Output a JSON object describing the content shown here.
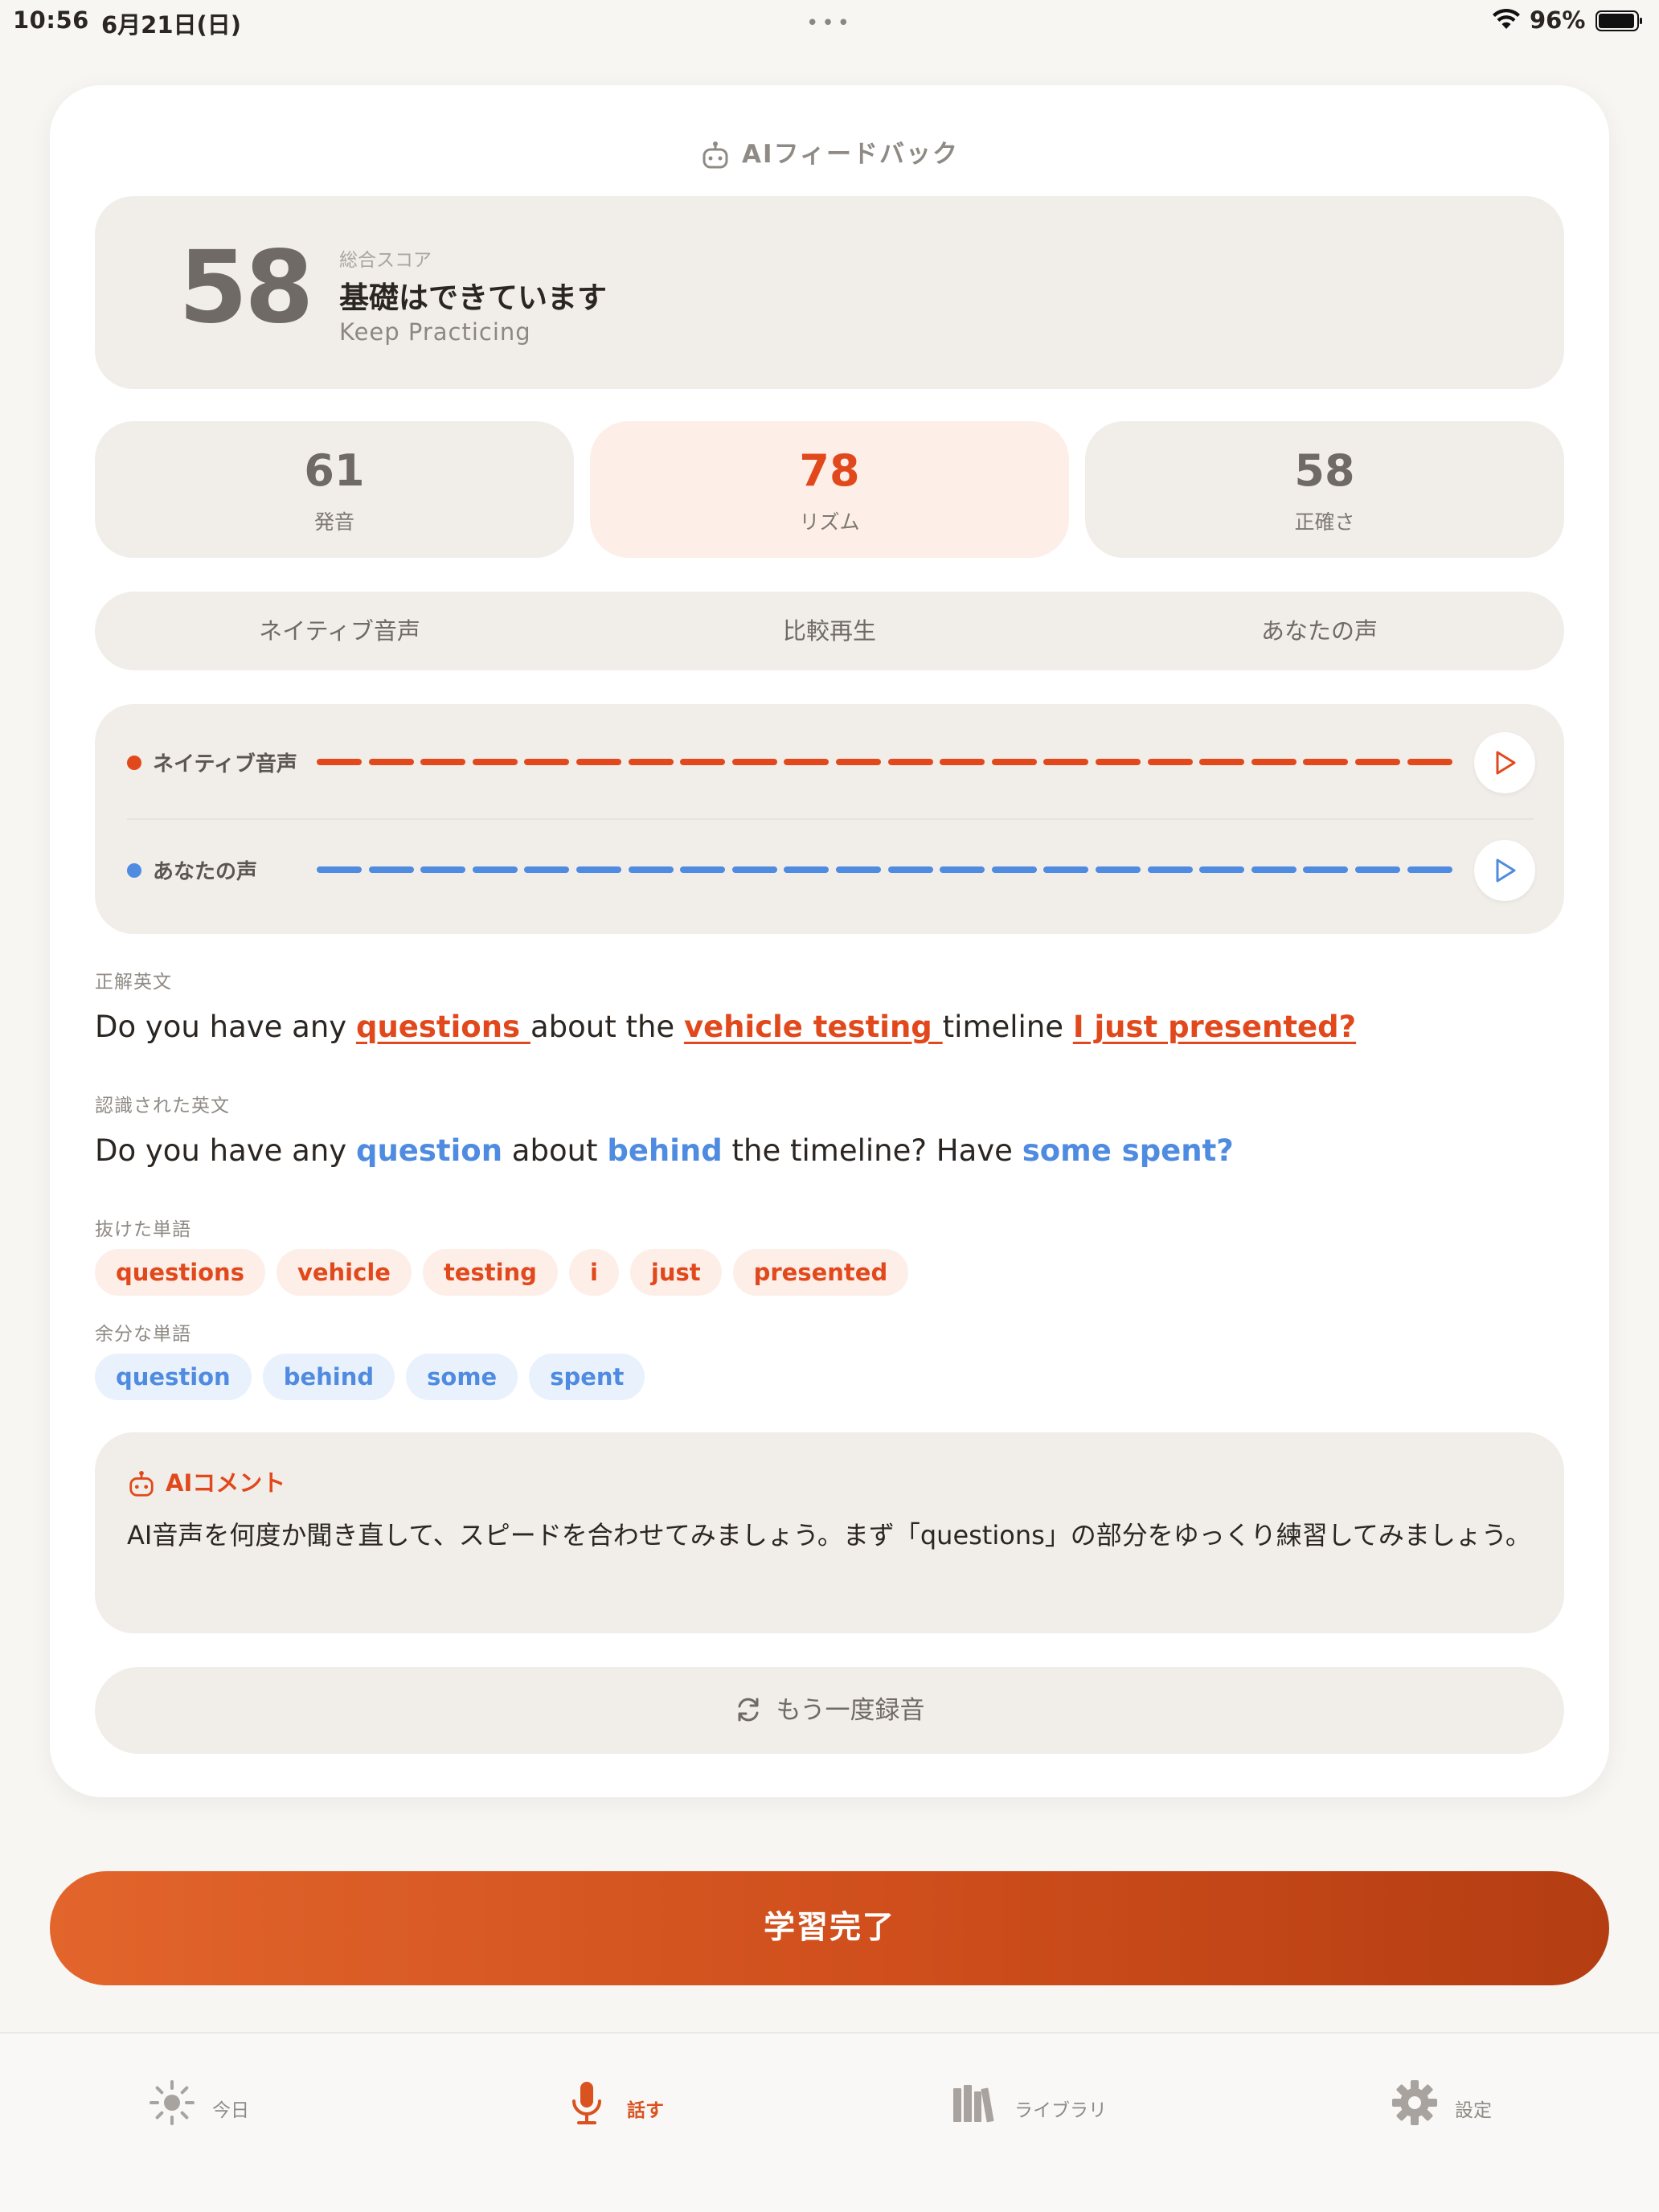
{
  "status_bar": {
    "time": "10:56",
    "date": "6月21日(日)",
    "dots": "•••",
    "battery": "96%"
  },
  "header": {
    "title": "AIフィードバック",
    "icon": "robot-icon"
  },
  "score": {
    "value": "58",
    "label": "総合スコア",
    "title": "基礎はできています",
    "subtitle": "Keep Practicing"
  },
  "metrics": [
    {
      "value": "61",
      "label": "発音"
    },
    {
      "value": "78",
      "label": "リズム"
    },
    {
      "value": "58",
      "label": "正確さ"
    }
  ],
  "tabs": [
    "ネイティブ音声",
    "比較再生",
    "あなたの声"
  ],
  "waves": {
    "native": {
      "label": "ネイティブ音声",
      "color": "#e1491c"
    },
    "user": {
      "label": "あなたの声",
      "color": "#4f8be0"
    }
  },
  "correct": {
    "label": "正解英文",
    "parts": [
      {
        "t": "Do you have any ",
        "k": "plain"
      },
      {
        "t": "questions ",
        "k": "miss"
      },
      {
        "t": "about the ",
        "k": "plain"
      },
      {
        "t": "vehicle testing ",
        "k": "miss"
      },
      {
        "t": "timeline ",
        "k": "plain"
      },
      {
        "t": "I just presented?",
        "k": "miss"
      }
    ]
  },
  "recognized": {
    "label": "認識された英文",
    "parts": [
      {
        "t": "Do you have any ",
        "k": "plain"
      },
      {
        "t": "question",
        "k": "extra"
      },
      {
        "t": " about ",
        "k": "plain"
      },
      {
        "t": "behind",
        "k": "extra"
      },
      {
        "t": " the timeline? Have ",
        "k": "plain"
      },
      {
        "t": "some spent?",
        "k": "extra"
      }
    ]
  },
  "missing": {
    "label": "抜けた単語",
    "words": [
      "questions",
      "vehicle",
      "testing",
      "i",
      "just",
      "presented"
    ]
  },
  "extra": {
    "label": "余分な単語",
    "words": [
      "question",
      "behind",
      "some",
      "spent"
    ]
  },
  "comment": {
    "title": "AIコメント",
    "text": "AI音声を何度か聞き直して、スピードを合わせてみましょう。まず「questions」の部分をゆっくり練習してみましょう。"
  },
  "retry_label": "もう一度録音",
  "complete_label": "学習完了",
  "tabbar": [
    {
      "label": "今日",
      "icon": "sun-icon"
    },
    {
      "label": "話す",
      "icon": "microphone-icon"
    },
    {
      "label": "ライブラリ",
      "icon": "library-icon"
    },
    {
      "label": "設定",
      "icon": "gear-icon"
    }
  ]
}
